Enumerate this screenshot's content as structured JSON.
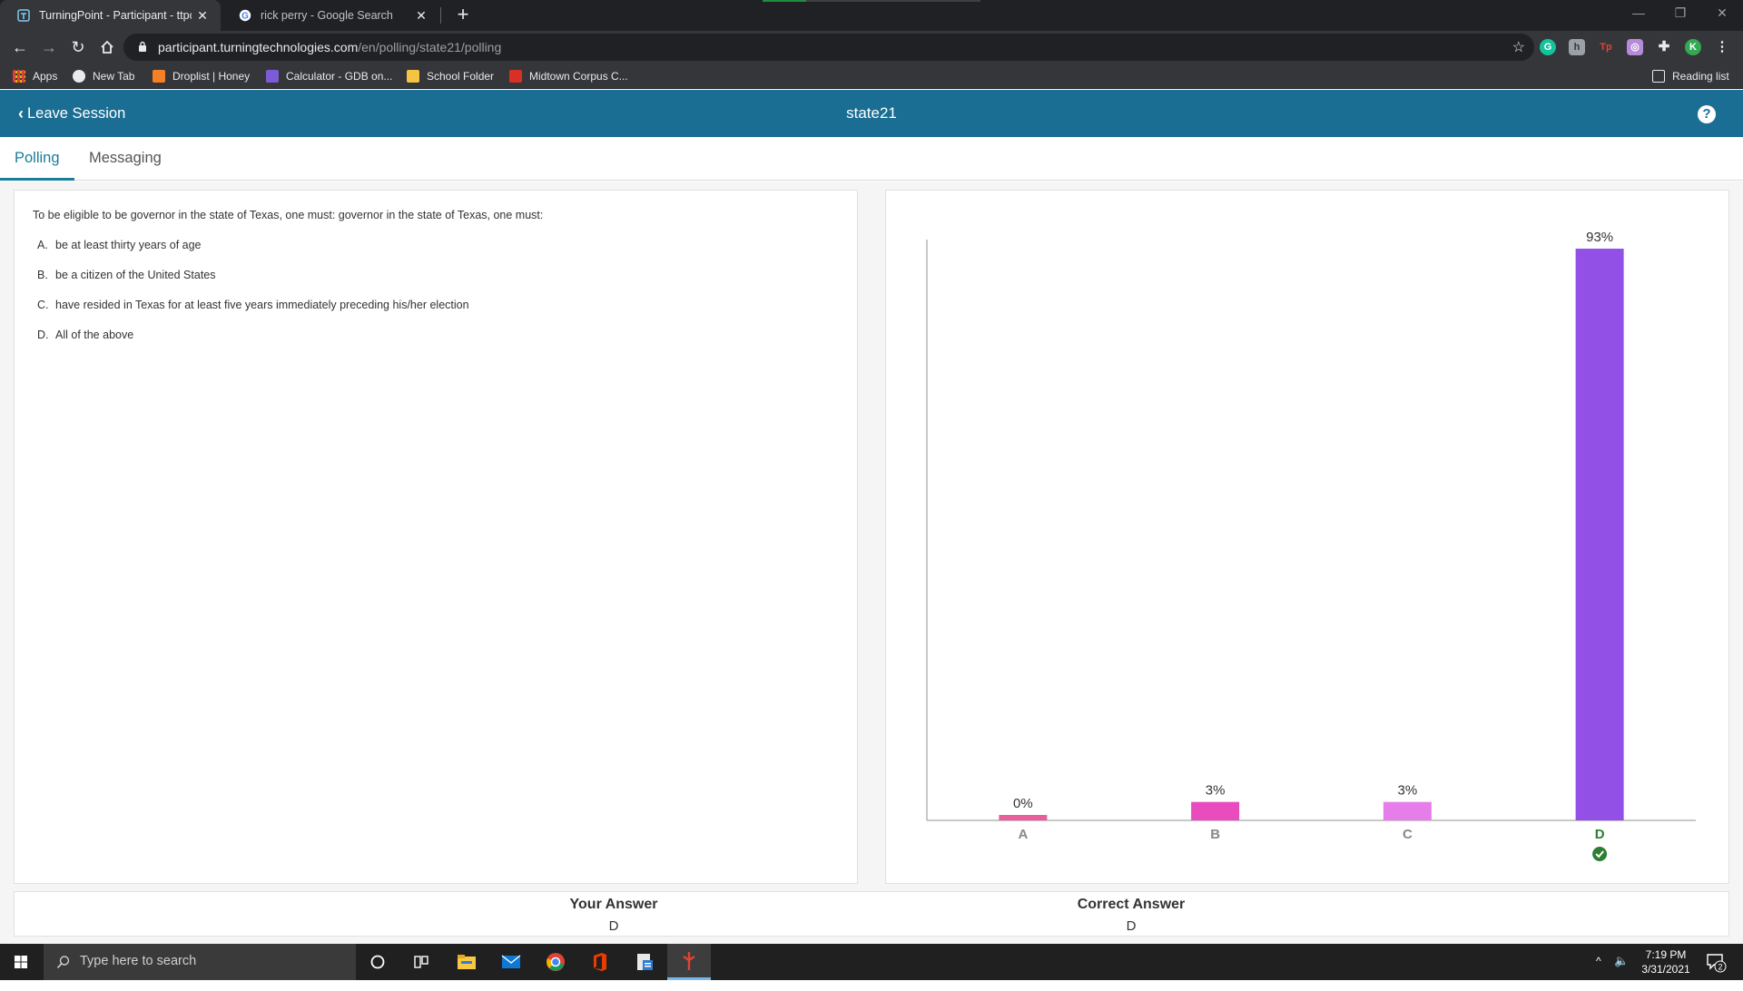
{
  "browser": {
    "tabs": [
      {
        "title": "TurningPoint - Participant - ttpoll",
        "active": true
      },
      {
        "title": "rick perry - Google Search",
        "active": false
      }
    ],
    "url_host": "participant.turningtechnologies.com",
    "url_path": "/en/polling/state21/polling",
    "bookmarks": [
      "Apps",
      "New Tab",
      "Droplist | Honey",
      "Calculator - GDB on...",
      "School Folder",
      "Midtown Corpus C..."
    ],
    "reading_list": "Reading list",
    "profile_initial": "K"
  },
  "header": {
    "leave_label": "Leave Session",
    "session_title": "state21",
    "help_label": "?"
  },
  "subtabs": [
    {
      "label": "Polling",
      "active": true
    },
    {
      "label": "Messaging",
      "active": false
    }
  ],
  "question": {
    "text": "To be eligible to be governor in the state of Texas, one must: governor in the state of Texas, one must:",
    "answers": [
      {
        "letter": "A.",
        "text": "be at least thirty years of age"
      },
      {
        "letter": "B.",
        "text": "be a citizen of the United States"
      },
      {
        "letter": "C.",
        "text": "have resided in Texas for at least five years immediately preceding his/her election"
      },
      {
        "letter": "D.",
        "text": "All of the above"
      }
    ]
  },
  "chart_data": {
    "type": "bar",
    "categories": [
      "A",
      "B",
      "C",
      "D"
    ],
    "values": [
      0,
      3,
      3,
      93
    ],
    "value_labels": [
      "0%",
      "3%",
      "3%",
      "93%"
    ],
    "colors": [
      "#e85d9a",
      "#e94cbc",
      "#e57ee8",
      "#9250e6"
    ],
    "correct_category": "D",
    "ylim": [
      0,
      93
    ]
  },
  "result": {
    "your_answer_label": "Your Answer",
    "your_answer_value": "D",
    "correct_answer_label": "Correct Answer",
    "correct_answer_value": "D"
  },
  "taskbar": {
    "search_placeholder": "Type here to search",
    "time": "7:19 PM",
    "date": "3/31/2021",
    "notification_count": "2"
  }
}
